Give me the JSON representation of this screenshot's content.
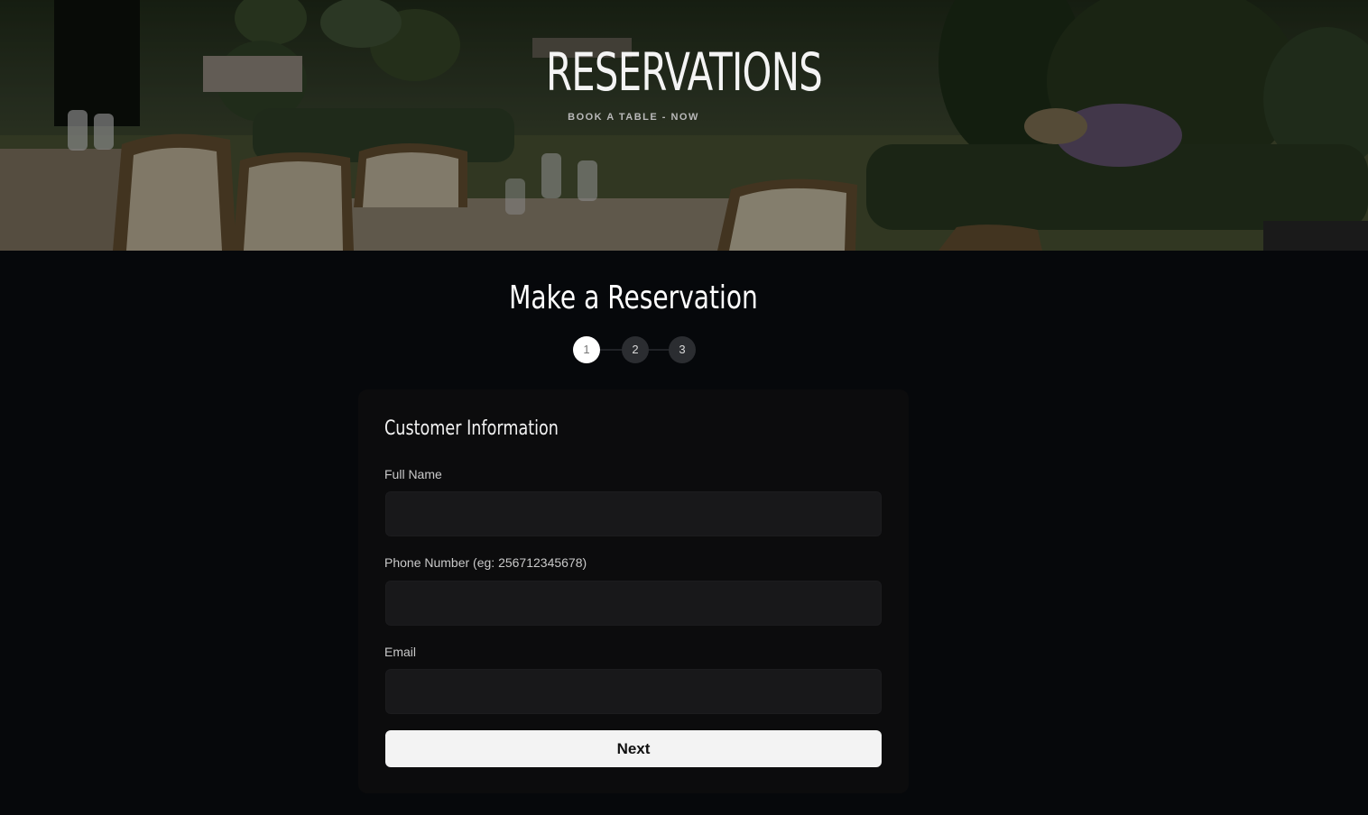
{
  "hero": {
    "title": "RESERVATIONS",
    "subtitle": "BOOK A TABLE - NOW"
  },
  "main": {
    "title": "Make a Reservation",
    "steps": [
      {
        "label": "1",
        "active": true
      },
      {
        "label": "2",
        "active": false
      },
      {
        "label": "3",
        "active": false
      }
    ]
  },
  "form": {
    "section_title": "Customer Information",
    "fields": {
      "full_name": {
        "label": "Full Name",
        "value": "",
        "placeholder": ""
      },
      "phone": {
        "label": "Phone Number (eg: 256712345678)",
        "value": "",
        "placeholder": ""
      },
      "email": {
        "label": "Email",
        "value": "",
        "placeholder": ""
      }
    },
    "next_label": "Next"
  },
  "colors": {
    "page_bg": "#06080b",
    "card_bg": "#0c0c0d",
    "input_bg": "#18181a",
    "button_bg": "#f3f3f3",
    "step_active": "#ffffff",
    "step_inactive": "#2b2d31"
  }
}
